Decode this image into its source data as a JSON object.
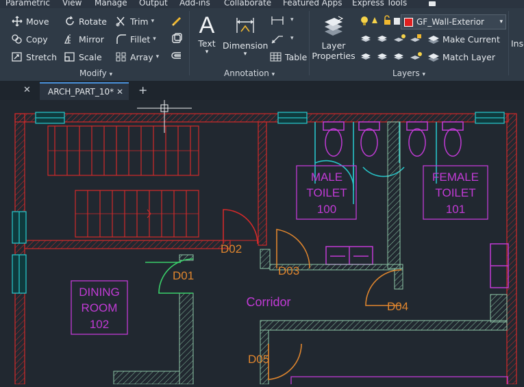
{
  "menu": {
    "tabs": [
      "Parametric",
      "View",
      "Manage",
      "Output",
      "Add-ins",
      "Collaborate",
      "Featured Apps",
      "Express Tools"
    ]
  },
  "ribbon": {
    "modify": {
      "title": "Modify",
      "move": "Move",
      "rotate": "Rotate",
      "trim": "Trim",
      "copy": "Copy",
      "mirror": "Mirror",
      "fillet": "Fillet",
      "stretch": "Stretch",
      "scale": "Scale",
      "array": "Array"
    },
    "annotation": {
      "title": "Annotation",
      "text": "Text",
      "dimension": "Dimension",
      "table": "Table"
    },
    "layers": {
      "title": "Layers",
      "layer_properties_line1": "Layer",
      "layer_properties_line2": "Properties",
      "current_layer": "GF_Wall-Exterior",
      "make_current": "Make Current",
      "match_layer": "Match Layer"
    },
    "insert_partial": "Inse"
  },
  "doc_tabs": {
    "active_tab": "ARCH_PART_10*"
  },
  "drawing": {
    "rooms": {
      "male_line1": "MALE",
      "male_line2": "TOILET",
      "male_num": "100",
      "female_line1": "FEMALE",
      "female_line2": "TOILET",
      "female_num": "101",
      "dining_line1": "DINING",
      "dining_line2": "ROOM",
      "dining_num": "102",
      "corridor": "Corridor"
    },
    "doors": [
      "D01",
      "D02",
      "D03",
      "D04",
      "D05"
    ]
  },
  "colors": {
    "wall_red": "#d42a2a",
    "glazing_cyan": "#27c4c8",
    "room_magenta": "#c23bd6",
    "door_orange": "#e0862e",
    "hatch_green": "#8fc8a8"
  }
}
